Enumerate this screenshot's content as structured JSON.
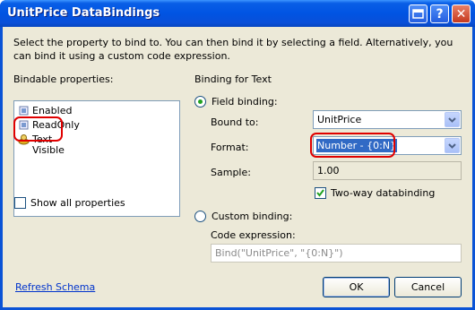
{
  "window": {
    "title": "UnitPrice DataBindings",
    "title_buttons": [
      "help-button",
      "question-button",
      "close-button"
    ]
  },
  "instructions": "Select the property to bind to. You can then bind it by selecting a field. Alternatively, you can bind it using a custom code expression.",
  "bindable": {
    "label": "Bindable properties:",
    "items": [
      {
        "label": "Enabled",
        "icon": "property-icon"
      },
      {
        "label": "ReadOnly",
        "icon": "property-icon"
      },
      {
        "label": "Text",
        "icon": "bound-property-icon"
      },
      {
        "label": "Visible",
        "icon": "property-icon"
      }
    ],
    "show_all_label": "Show all properties"
  },
  "binding": {
    "heading": "Binding for Text",
    "field_binding_label": "Field binding:",
    "bound_to_label": "Bound to:",
    "bound_to_value": "UnitPrice",
    "format_label": "Format:",
    "format_value": "Number - {0:N}",
    "sample_label": "Sample:",
    "sample_value": "1.00",
    "two_way_label": "Two-way databinding",
    "custom_binding_label": "Custom binding:",
    "code_expression_label": "Code expression:",
    "code_expression_value": "Bind(\"UnitPrice\", \"{0:N}\")"
  },
  "footer": {
    "refresh_label": "Refresh Schema",
    "ok_label": "OK",
    "cancel_label": "Cancel"
  }
}
